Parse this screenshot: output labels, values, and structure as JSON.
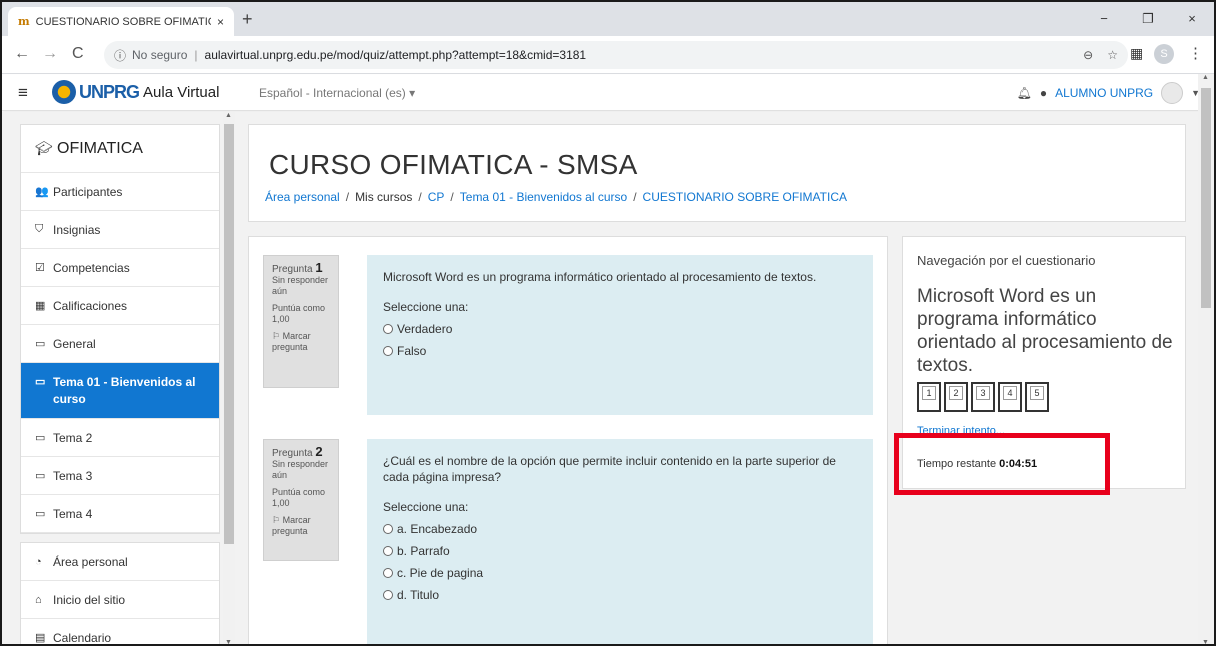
{
  "browser": {
    "tab_title": "CUESTIONARIO SOBRE OFIMATIC",
    "tab_icon": "m",
    "tab_close": "×",
    "new_tab": "+",
    "window_controls": [
      "−",
      "❐",
      "×"
    ],
    "not_secure": "No seguro",
    "url": "aulavirtual.unprg.edu.pe/mod/quiz/attempt.php?attempt=18&cmid=3181",
    "profile_initial": "S"
  },
  "navbar": {
    "brand": "UNPRG",
    "site_name": "Aula Virtual",
    "language": "Español - Internacional (es) ▾",
    "user_name": "ALUMNO UNPRG"
  },
  "sidebar": {
    "course": "OFIMATICA",
    "items": [
      {
        "label": "Participantes",
        "icon": "users-icon",
        "glyph": "👥"
      },
      {
        "label": "Insignias",
        "icon": "shield-icon",
        "glyph": "⛉"
      },
      {
        "label": "Competencias",
        "icon": "checkbox-icon",
        "glyph": "☑"
      },
      {
        "label": "Calificaciones",
        "icon": "table-icon",
        "glyph": "▦"
      },
      {
        "label": "General",
        "icon": "folder-icon",
        "glyph": "▭"
      },
      {
        "label": "Tema 01 - Bienvenidos al curso",
        "icon": "folder-icon",
        "glyph": "▭",
        "active": true
      },
      {
        "label": "Tema 2",
        "icon": "folder-icon",
        "glyph": "▭"
      },
      {
        "label": "Tema 3",
        "icon": "folder-icon",
        "glyph": "▭"
      },
      {
        "label": "Tema 4",
        "icon": "folder-icon",
        "glyph": "▭"
      }
    ],
    "items2": [
      {
        "label": "Área personal",
        "icon": "dashboard-icon",
        "glyph": "◔"
      },
      {
        "label": "Inicio del sitio",
        "icon": "home-icon",
        "glyph": "⌂"
      },
      {
        "label": "Calendario",
        "icon": "calendar-icon",
        "glyph": "▤"
      }
    ]
  },
  "header": {
    "title": "CURSO OFIMATICA - SMSA",
    "breadcrumb": [
      "Área personal",
      "Mis cursos",
      "CP",
      "Tema 01 - Bienvenidos al curso",
      "CUESTIONARIO SOBRE OFIMATICA"
    ]
  },
  "questions": [
    {
      "label": "Pregunta",
      "number": "1",
      "status": "Sin responder aún",
      "score": "Puntúa como 1,00",
      "flag": "Marcar pregunta",
      "text": "Microsoft Word es un programa informático orientado al procesamiento de textos.",
      "select": "Seleccione una:",
      "options": [
        "Verdadero",
        "Falso"
      ]
    },
    {
      "label": "Pregunta",
      "number": "2",
      "status": "Sin responder aún",
      "score": "Puntúa como 1,00",
      "flag": "Marcar pregunta",
      "text": "¿Cuál es el nombre de la opción que permite incluir contenido en la parte superior de cada página impresa?",
      "select": "Seleccione una:",
      "options": [
        "a. Encabezado",
        "b. Parrafo",
        "c. Pie de pagina",
        "d. Titulo"
      ]
    }
  ],
  "quiz_nav": {
    "heading": "Navegación por el cuestionario",
    "big_text": "Microsoft Word es un programa informático orientado al procesamiento de textos.",
    "buttons": [
      "1",
      "2",
      "3",
      "4",
      "5"
    ],
    "finish": "Terminar intento...",
    "timer_label": "Tiempo restante",
    "timer_value": "0:04:51"
  },
  "colors": {
    "accent": "#1177d1",
    "highlight_box": "#e8001c",
    "question_bg": "#dcedf2"
  }
}
